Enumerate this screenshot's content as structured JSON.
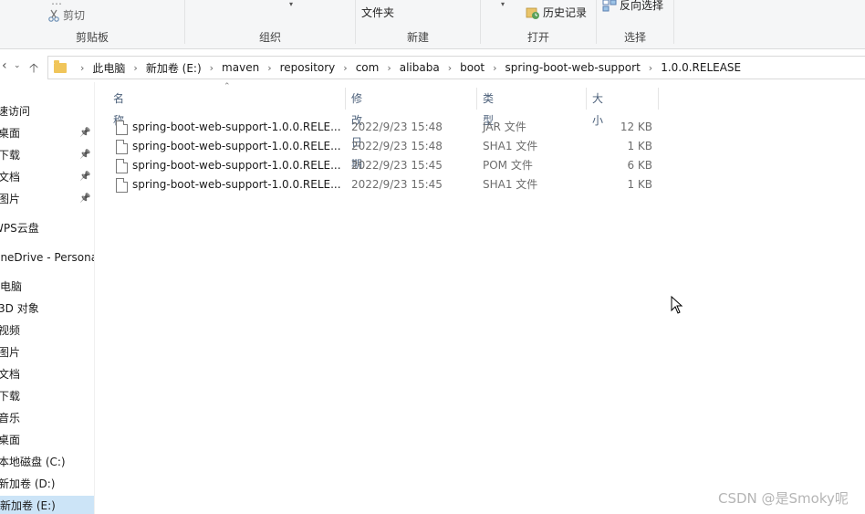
{
  "ribbon": {
    "clipboard": {
      "partial_top": "…",
      "cut_label": "剪切",
      "group_label": "剪贴板"
    },
    "organize": {
      "group_label": "组织"
    },
    "new": {
      "folder_label": "文件夹",
      "group_label": "新建"
    },
    "open": {
      "history_label": "历史记录",
      "group_label": "打开"
    },
    "select": {
      "invert_label": "反向选择",
      "group_label": "选择"
    }
  },
  "address": {
    "crumbs": [
      "此电脑",
      "新加卷 (E:)",
      "maven",
      "repository",
      "com",
      "alibaba",
      "boot",
      "spring-boot-web-support",
      "1.0.0.RELEASE"
    ]
  },
  "navpane": {
    "items": [
      {
        "label": "快速访问",
        "pinned": false,
        "selected": false
      },
      {
        "label": "桌面",
        "pinned": true,
        "selected": false
      },
      {
        "label": "下载",
        "pinned": true,
        "selected": false
      },
      {
        "label": "文档",
        "pinned": true,
        "selected": false
      },
      {
        "label": "图片",
        "pinned": true,
        "selected": false
      },
      {
        "label": "WPS云盘",
        "pinned": false,
        "selected": false
      },
      {
        "label": "OneDrive - Personal",
        "pinned": false,
        "selected": false
      },
      {
        "label": "此电脑",
        "pinned": false,
        "selected": false
      },
      {
        "label": "3D 对象",
        "pinned": false,
        "selected": false
      },
      {
        "label": "视频",
        "pinned": false,
        "selected": false
      },
      {
        "label": "图片",
        "pinned": false,
        "selected": false
      },
      {
        "label": "文档",
        "pinned": false,
        "selected": false
      },
      {
        "label": "下载",
        "pinned": false,
        "selected": false
      },
      {
        "label": "音乐",
        "pinned": false,
        "selected": false
      },
      {
        "label": "桌面",
        "pinned": false,
        "selected": false
      },
      {
        "label": "本地磁盘 (C:)",
        "pinned": false,
        "selected": false
      },
      {
        "label": "新加卷 (D:)",
        "pinned": false,
        "selected": false
      },
      {
        "label": "新加卷 (E:)",
        "pinned": false,
        "selected": true
      }
    ]
  },
  "columns": {
    "name": "名称",
    "date": "修改日期",
    "type": "类型",
    "size": "大小"
  },
  "files": [
    {
      "name": "spring-boot-web-support-1.0.0.RELE...",
      "date": "2022/9/23 15:48",
      "type": "JAR 文件",
      "size": "12 KB"
    },
    {
      "name": "spring-boot-web-support-1.0.0.RELE...",
      "date": "2022/9/23 15:48",
      "type": "SHA1 文件",
      "size": "1 KB"
    },
    {
      "name": "spring-boot-web-support-1.0.0.RELE...",
      "date": "2022/9/23 15:45",
      "type": "POM 文件",
      "size": "6 KB"
    },
    {
      "name": "spring-boot-web-support-1.0.0.RELE...",
      "date": "2022/9/23 15:45",
      "type": "SHA1 文件",
      "size": "1 KB"
    }
  ],
  "watermark": "CSDN @是Smoky呢",
  "colors": {
    "selection": "#cce4f7",
    "header_text": "#4c607a",
    "folder": "#f0c55a"
  }
}
